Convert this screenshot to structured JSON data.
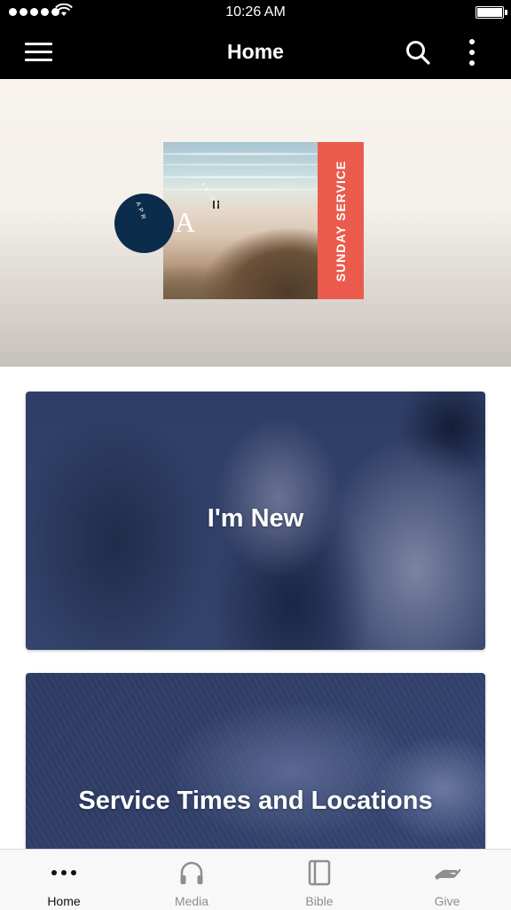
{
  "status_bar": {
    "time": "10:26 AM"
  },
  "nav": {
    "title": "Home",
    "menu_icon": "hamburger-icon",
    "search_icon": "search-icon",
    "more_icon": "more-vertical-icon"
  },
  "hero": {
    "band_text": "SUNDAY SERVICE",
    "logo_letter": "A",
    "circle_text": "APR",
    "arc_text": "FEIDG"
  },
  "tiles": [
    {
      "label": "I'm New"
    },
    {
      "label": "Service Times and Locations"
    }
  ],
  "tab_bar": {
    "items": [
      {
        "label": "Home",
        "icon": "more-horizontal-icon",
        "active": true
      },
      {
        "label": "Media",
        "icon": "headphones-icon",
        "active": false
      },
      {
        "label": "Bible",
        "icon": "book-icon",
        "active": false
      },
      {
        "label": "Give",
        "icon": "give-hand-icon",
        "active": false
      }
    ]
  },
  "colors": {
    "nav_background": "#000000",
    "tile_overlay": "#2f3e66",
    "accent_red": "#ea5b4d",
    "circle_navy": "#0c2c4b"
  }
}
